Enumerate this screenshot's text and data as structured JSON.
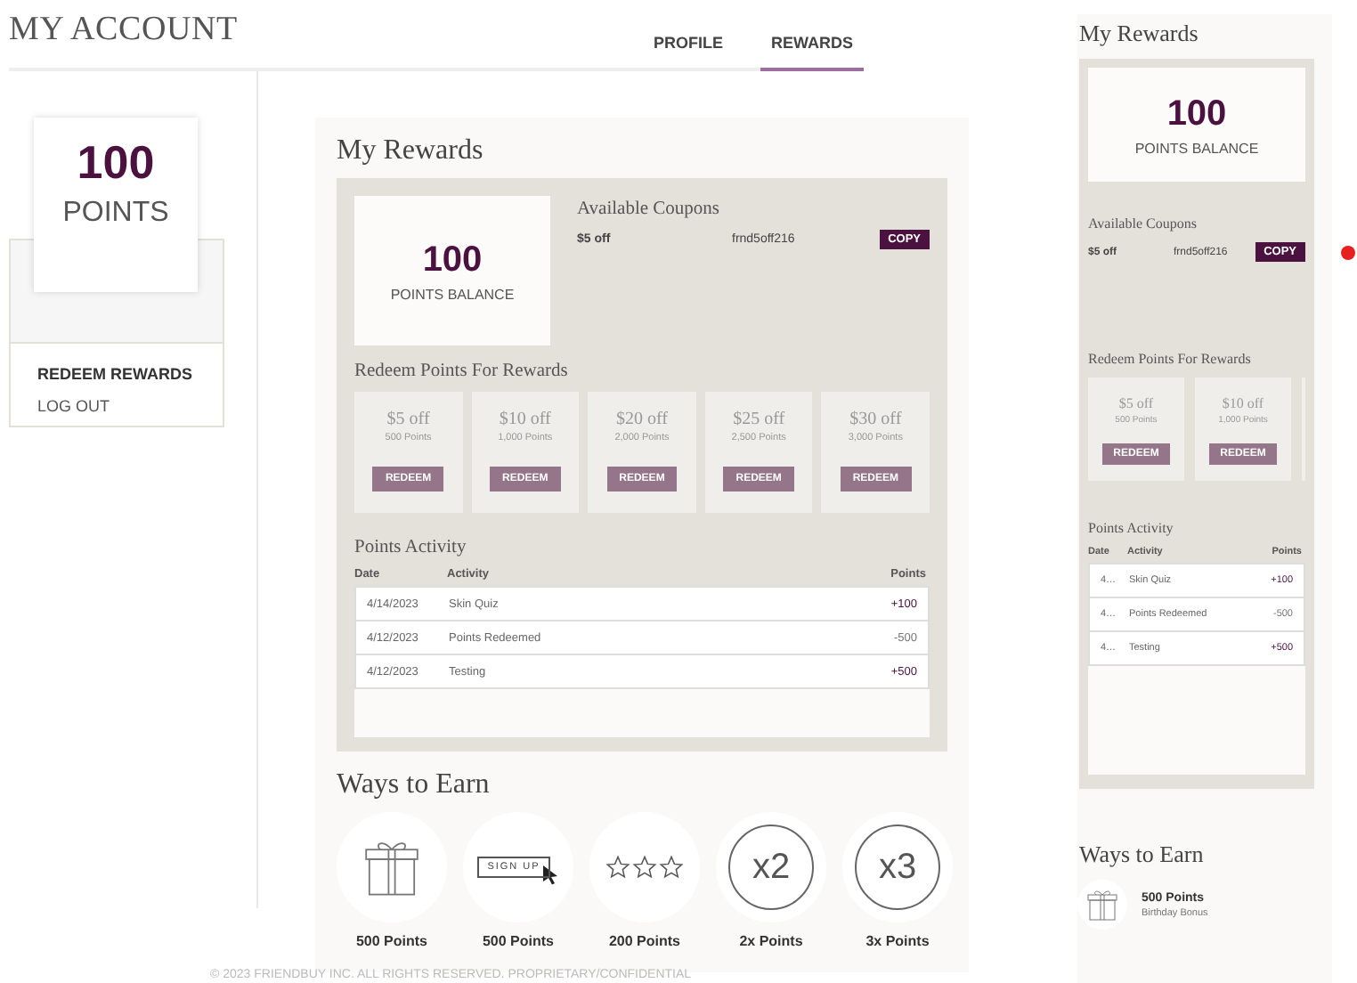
{
  "header": {
    "title": "MY ACCOUNT",
    "tabs": [
      {
        "label": "PROFILE",
        "selected": false
      },
      {
        "label": "REWARDS",
        "selected": true
      }
    ]
  },
  "sidebar": {
    "points": "100",
    "points_label": "POINTS",
    "links": [
      {
        "label": "REDEEM REWARDS",
        "selected": true
      },
      {
        "label": "LOG OUT",
        "selected": false
      }
    ]
  },
  "main": {
    "title": "My Rewards",
    "balance": {
      "value": "100",
      "label": "POINTS BALANCE"
    },
    "coupons": {
      "title": "Available Coupons",
      "items": [
        {
          "amount": "$5 off",
          "code": "frnd5off216",
          "button": "COPY"
        }
      ]
    },
    "redeem": {
      "title": "Redeem Points For Rewards",
      "rewards": [
        {
          "title": "$5 off",
          "points": "500 Points",
          "button": "REDEEM"
        },
        {
          "title": "$10 off",
          "points": "1,000 Points",
          "button": "REDEEM"
        },
        {
          "title": "$20 off",
          "points": "2,000 Points",
          "button": "REDEEM"
        },
        {
          "title": "$25 off",
          "points": "2,500 Points",
          "button": "REDEEM"
        },
        {
          "title": "$30 off",
          "points": "3,000 Points",
          "button": "REDEEM"
        }
      ]
    },
    "activity": {
      "title": "Points Activity",
      "columns": [
        "Date",
        "Activity",
        "Points"
      ],
      "rows": [
        {
          "date": "4/14/2023",
          "activity": "Skin Quiz",
          "points": "+100",
          "kind": "earned"
        },
        {
          "date": "4/12/2023",
          "activity": "Points Redeemed",
          "points": "-500",
          "kind": "redeemed"
        },
        {
          "date": "4/12/2023",
          "activity": "Testing",
          "points": "+500",
          "kind": "earned"
        }
      ]
    },
    "ways": {
      "title": "Ways to Earn",
      "items": [
        {
          "kind": "gift",
          "points": "500 Points"
        },
        {
          "kind": "signup",
          "icon_text": "SIGN UP",
          "points": "500 Points"
        },
        {
          "kind": "stars",
          "points": "200 Points"
        },
        {
          "kind": "multiplier",
          "icon_text": "x2",
          "points": "2x Points"
        },
        {
          "kind": "multiplier",
          "icon_text": "x3",
          "points": "3x Points"
        }
      ]
    }
  },
  "mobile": {
    "title": "My Rewards",
    "balance": {
      "value": "100",
      "label": "POINTS BALANCE"
    },
    "coupons": {
      "title": "Available Coupons",
      "items": [
        {
          "amount": "$5 off",
          "code": "frnd5off216",
          "button": "COPY"
        }
      ]
    },
    "redeem": {
      "title": "Redeem Points For Rewards",
      "rewards": [
        {
          "title": "$5 off",
          "points": "500 Points",
          "button": "REDEEM"
        },
        {
          "title": "$10 off",
          "points": "1,000 Points",
          "button": "REDEEM"
        }
      ]
    },
    "activity": {
      "title": "Points Activity",
      "columns": [
        "Date",
        "Activity",
        "Points"
      ],
      "rows": [
        {
          "date": "4…",
          "activity": "Skin Quiz",
          "points": "+100",
          "kind": "earned"
        },
        {
          "date": "4…",
          "activity": "Points Redeemed",
          "points": "-500",
          "kind": "redeemed"
        },
        {
          "date": "4…",
          "activity": "Testing",
          "points": "+500",
          "kind": "earned"
        }
      ]
    },
    "ways": {
      "title": "Ways to Earn",
      "items": [
        {
          "kind": "gift",
          "points": "500 Points",
          "description": "Birthday Bonus"
        }
      ]
    }
  },
  "footer": "© 2023 FRIENDBUY INC. ALL RIGHTS RESERVED. PROPRIETARY/CONFIDENTIAL"
}
